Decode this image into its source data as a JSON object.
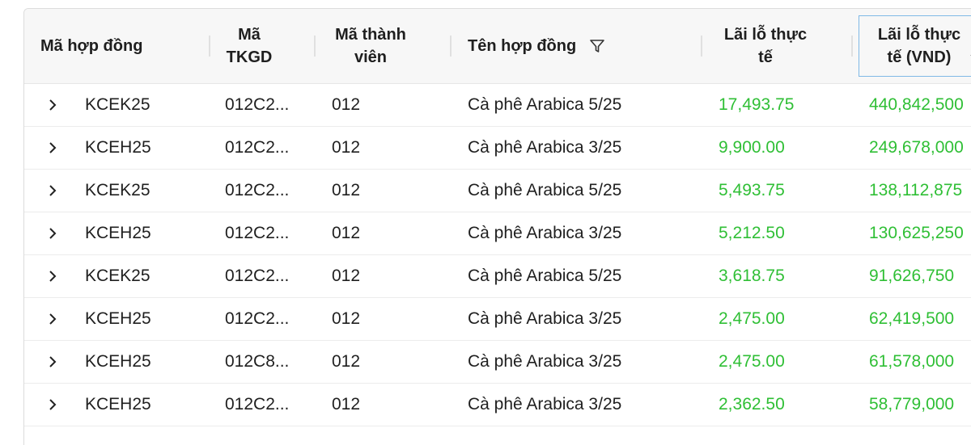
{
  "columns": [
    {
      "key": "code",
      "label": "Mã hợp đồng"
    },
    {
      "key": "account",
      "label": "Mã\nTKGD"
    },
    {
      "key": "member",
      "label": "Mã thành\nviên"
    },
    {
      "key": "name",
      "label": "Tên hợp đồng"
    },
    {
      "key": "pl",
      "label": "Lãi lỗ thực\ntế"
    },
    {
      "key": "pl_vnd",
      "label": "Lãi lỗ thực\ntế (VND)"
    }
  ],
  "rows": [
    {
      "code": "KCEK25",
      "account": "012C2...",
      "member": "012",
      "name": "Cà phê Arabica 5/25",
      "pl": "17,493.75",
      "pl_vnd": "440,842,500"
    },
    {
      "code": "KCEH25",
      "account": "012C2...",
      "member": "012",
      "name": "Cà phê Arabica 3/25",
      "pl": "9,900.00",
      "pl_vnd": "249,678,000"
    },
    {
      "code": "KCEK25",
      "account": "012C2...",
      "member": "012",
      "name": "Cà phê Arabica 5/25",
      "pl": "5,493.75",
      "pl_vnd": "138,112,875"
    },
    {
      "code": "KCEH25",
      "account": "012C2...",
      "member": "012",
      "name": "Cà phê Arabica 3/25",
      "pl": "5,212.50",
      "pl_vnd": "130,625,250"
    },
    {
      "code": "KCEK25",
      "account": "012C2...",
      "member": "012",
      "name": "Cà phê Arabica 5/25",
      "pl": "3,618.75",
      "pl_vnd": "91,626,750"
    },
    {
      "code": "KCEH25",
      "account": "012C2...",
      "member": "012",
      "name": "Cà phê Arabica 3/25",
      "pl": "2,475.00",
      "pl_vnd": "62,419,500"
    },
    {
      "code": "KCEH25",
      "account": "012C8...",
      "member": "012",
      "name": "Cà phê Arabica 3/25",
      "pl": "2,475.00",
      "pl_vnd": "61,578,000"
    },
    {
      "code": "KCEH25",
      "account": "012C2...",
      "member": "012",
      "name": "Cà phê Arabica 3/25",
      "pl": "2,362.50",
      "pl_vnd": "58,779,000"
    }
  ],
  "colors": {
    "profit": "#2fbf35",
    "header_bg": "#f7f7f7",
    "active_border": "#7fb9e6"
  },
  "icons": {
    "filter": "filter-icon",
    "expand": "chevron-right-icon",
    "sort": "chevron-down-icon"
  }
}
